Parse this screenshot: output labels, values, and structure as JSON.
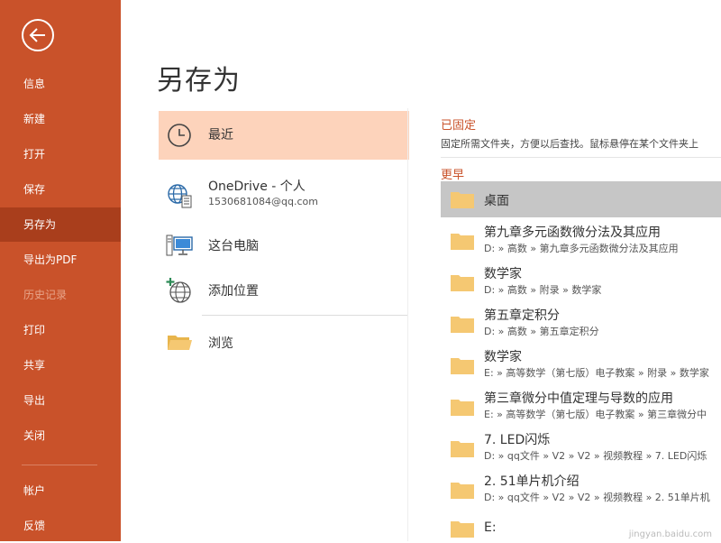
{
  "sidebar": {
    "items": [
      {
        "label": "信息"
      },
      {
        "label": "新建"
      },
      {
        "label": "打开"
      },
      {
        "label": "保存"
      },
      {
        "label": "另存为"
      },
      {
        "label": "导出为PDF"
      },
      {
        "label": "历史记录"
      },
      {
        "label": "打印"
      },
      {
        "label": "共享"
      },
      {
        "label": "导出"
      },
      {
        "label": "关闭"
      },
      {
        "label": "帐户"
      },
      {
        "label": "反馈"
      }
    ],
    "selected_index": 4,
    "disabled_index": 6
  },
  "page_title": "另存为",
  "locations": [
    {
      "label": "最近",
      "icon": "clock-icon"
    },
    {
      "label": "OneDrive - 个人",
      "sub": "1530681084@qq.com",
      "icon": "onedrive-globe-icon"
    },
    {
      "label": "这台电脑",
      "icon": "computer-icon"
    },
    {
      "label": "添加位置",
      "icon": "add-globe-icon"
    },
    {
      "label": "浏览",
      "icon": "folder-open-icon"
    }
  ],
  "pinned": {
    "heading": "已固定",
    "note": "固定所需文件夹，方便以后查找。鼠标悬停在某个文件夹上"
  },
  "earlier": {
    "heading": "更早",
    "folders": [
      {
        "name": "桌面",
        "path": ""
      },
      {
        "name": "第九章多元函数微分法及其应用",
        "path": "D: » 高数 » 第九章多元函数微分法及其应用"
      },
      {
        "name": "数学家",
        "path": "D: » 高数 » 附录 » 数学家"
      },
      {
        "name": "第五章定积分",
        "path": "D: » 高数 » 第五章定积分"
      },
      {
        "name": "数学家",
        "path": "E: » 高等数学（第七版）电子教案 » 附录 » 数学家"
      },
      {
        "name": "第三章微分中值定理与导数的应用",
        "path": "E: » 高等数学（第七版）电子教案 » 第三章微分中"
      },
      {
        "name": "7. LED闪烁",
        "path": "D: » qq文件 » V2 » V2 » 视频教程 » 7. LED闪烁"
      },
      {
        "name": "2. 51单片机介绍",
        "path": "D: » qq文件 » V2 » V2 » 视频教程 » 2. 51单片机"
      },
      {
        "name": "E:",
        "path": ""
      }
    ]
  },
  "watermark": "jingyan.baidu.com",
  "colors": {
    "accent": "#c9522a",
    "selected_sidebar": "#a93e1c",
    "selected_location": "#fdd3bb",
    "selected_folder": "#c6c6c6",
    "folder": "#f5c872"
  }
}
